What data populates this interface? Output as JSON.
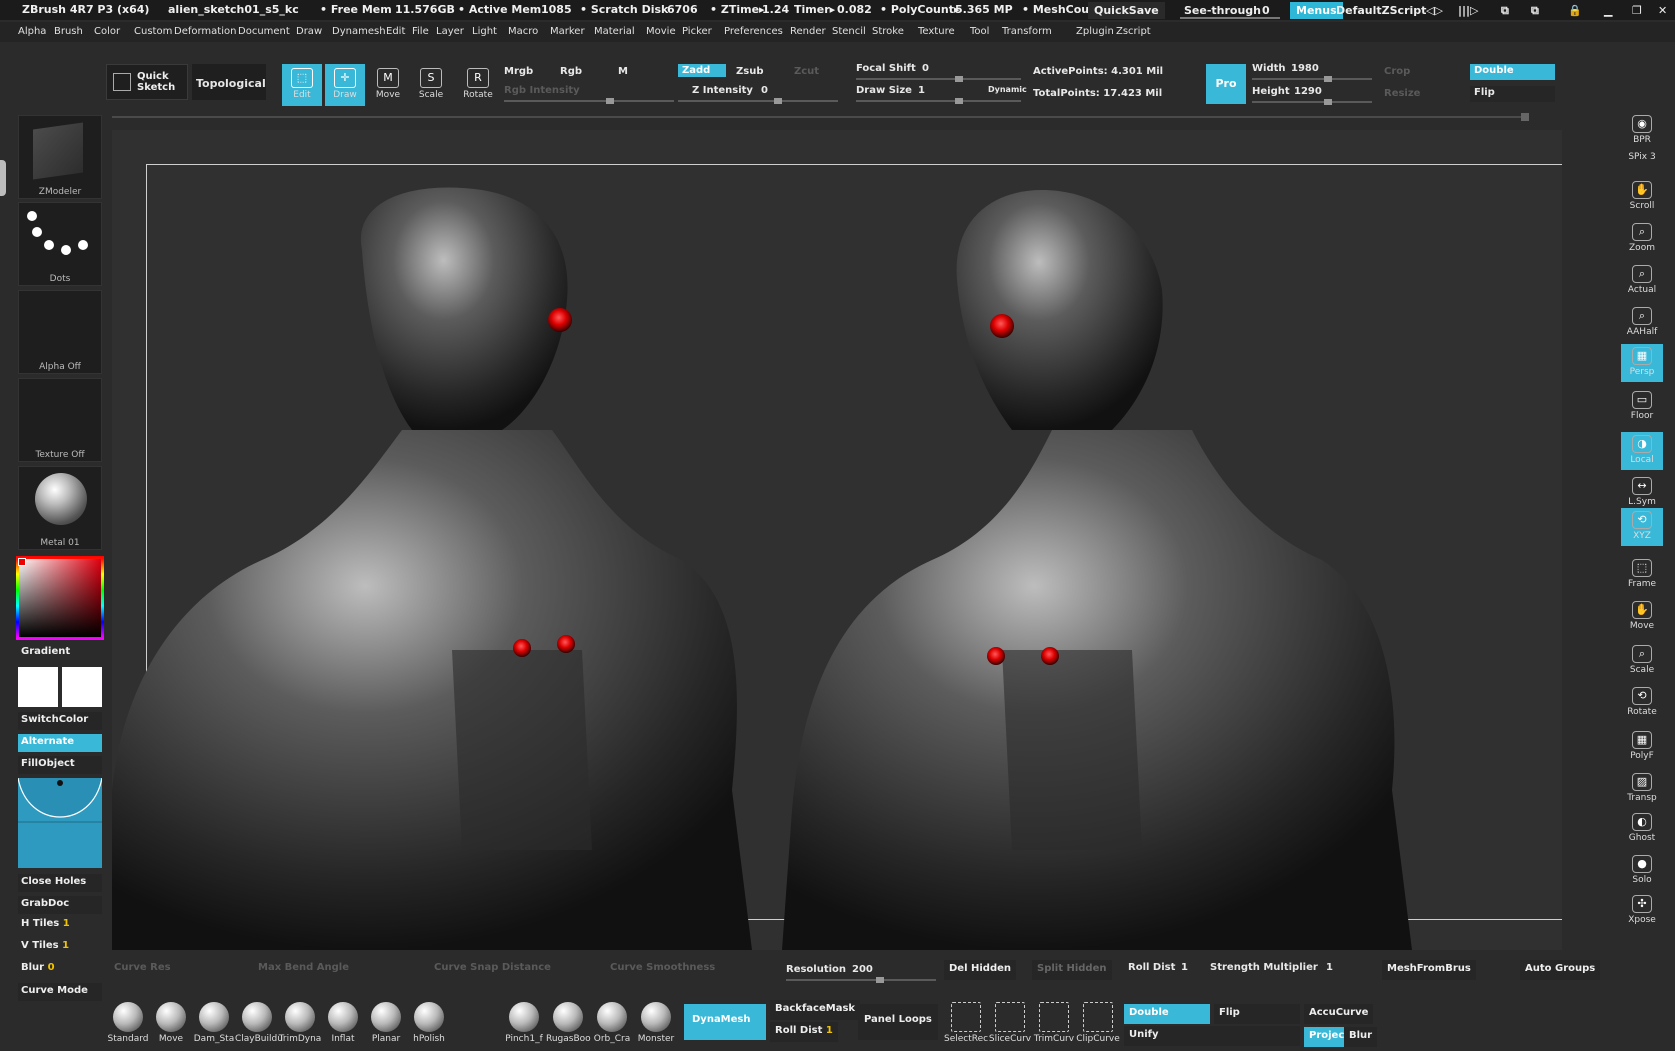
{
  "titlebar": {
    "app": "ZBrush 4R7 P3 (x64)",
    "file": "alien_sketch01_s5_kc",
    "free_mem_label": "• Free Mem",
    "free_mem": "11.576GB",
    "active_mem_label": "• Active Mem",
    "active_mem": "1085",
    "scratch_label": "• Scratch Disk",
    "scratch": "6706",
    "ztime_label": "• ZTime▸",
    "ztime": "1.24",
    "timer_label": "Timer▸",
    "timer": "0.082",
    "polycount_label": "• PolyCount▸",
    "polycount": "5.365 MP",
    "meshcount_label": "• MeshCou",
    "quicksave": "QuickSave",
    "seethrough_label": "See-through",
    "seethrough": "0",
    "menus": "Menus",
    "script": "DefaultZScript"
  },
  "menubar": [
    "Alpha",
    "Brush",
    "Color",
    "Custom",
    "Deformation",
    "Document",
    "Draw",
    "Dynamesh",
    "Edit",
    "File",
    "Layer",
    "Light",
    "Macro",
    "Marker",
    "Material",
    "Movie",
    "Picker",
    "Preferences",
    "Render",
    "Stencil",
    "Stroke",
    "Texture",
    "Tool",
    "Transform",
    "Zplugin",
    "Zscript"
  ],
  "toolbar": {
    "quick_sketch": "Quick Sketch",
    "topological": "Topological",
    "edit": "Edit",
    "draw": "Draw",
    "move": "Move",
    "scale": "Scale",
    "rotate": "Rotate",
    "mrgb": "Mrgb",
    "rgb": "Rgb",
    "m": "M",
    "zadd": "Zadd",
    "zsub": "Zsub",
    "zcut": "Zcut",
    "rgb_intensity": "Rgb Intensity",
    "z_intensity_label": "Z Intensity",
    "z_intensity": "0",
    "focal_shift_label": "Focal Shift",
    "focal_shift": "0",
    "draw_size_label": "Draw Size",
    "draw_size": "1",
    "dynamic": "Dynamic",
    "active_points": "ActivePoints: 4.301 Mil",
    "total_points": "TotalPoints: 17.423 Mil",
    "pro": "Pro",
    "width_label": "Width",
    "width": "1980",
    "height_label": "Height",
    "height": "1290",
    "crop": "Crop",
    "resize": "Resize",
    "double": "Double",
    "flip": "Flip"
  },
  "leftpanel": {
    "zmodeler": "ZModeler",
    "dots": "Dots",
    "alpha": "Alpha Off",
    "texture": "Texture Off",
    "material": "Metal 01",
    "gradient": "Gradient",
    "switchcolor": "SwitchColor",
    "alternate": "Alternate",
    "fillobject": "FillObject",
    "close_holes": "Close Holes",
    "grabdoc": "GrabDoc",
    "htiles_label": "H Tiles",
    "htiles": "1",
    "vtiles_label": "V Tiles",
    "vtiles": "1",
    "blur_label": "Blur",
    "blur": "0",
    "curve_mode": "Curve Mode"
  },
  "rightpanel": [
    "BPR",
    "SPix 3",
    "Scroll",
    "Zoom",
    "Actual",
    "AAHalf",
    "Persp",
    "Floor",
    "Local",
    "L.Sym",
    "XYZ",
    "Frame",
    "Move",
    "Scale",
    "Rotate",
    "PolyF",
    "Transp",
    "Ghost",
    "Solo",
    "Xpose"
  ],
  "bottom1": {
    "curve_res": "Curve Res",
    "max_bend": "Max Bend Angle",
    "snap": "Curve Snap Distance",
    "smooth": "Curve Smoothness",
    "resolution_label": "Resolution",
    "resolution": "200",
    "del_hidden": "Del Hidden",
    "split_hidden": "Split Hidden",
    "roll_dist_label": "Roll Dist",
    "roll_dist": "1",
    "strength_label": "Strength Multiplier",
    "strength": "1",
    "meshfrombrush": "MeshFromBrus",
    "auto_groups": "Auto Groups"
  },
  "bottom2": {
    "brushes": [
      "Standard",
      "Move",
      "Dam_Sta",
      "ClayBuildu",
      "TrimDyna",
      "Inflat",
      "Planar",
      "hPolish"
    ],
    "brushes2": [
      "Pinch1_f",
      "RugasBoo",
      "Orb_Cra",
      "Monster"
    ],
    "dynamesh": "DynaMesh",
    "backface": "BackfaceMask",
    "roll_dist_label": "Roll Dist",
    "roll_dist": "1",
    "panel_loops": "Panel Loops",
    "select_tools": [
      "SelectRec",
      "SliceCurv",
      "TrimCurv",
      "ClipCurve"
    ],
    "double": "Double",
    "flip": "Flip",
    "accucurve": "AccuCurve",
    "unify": "Unify",
    "project": "Projec",
    "blur": "Blur"
  }
}
